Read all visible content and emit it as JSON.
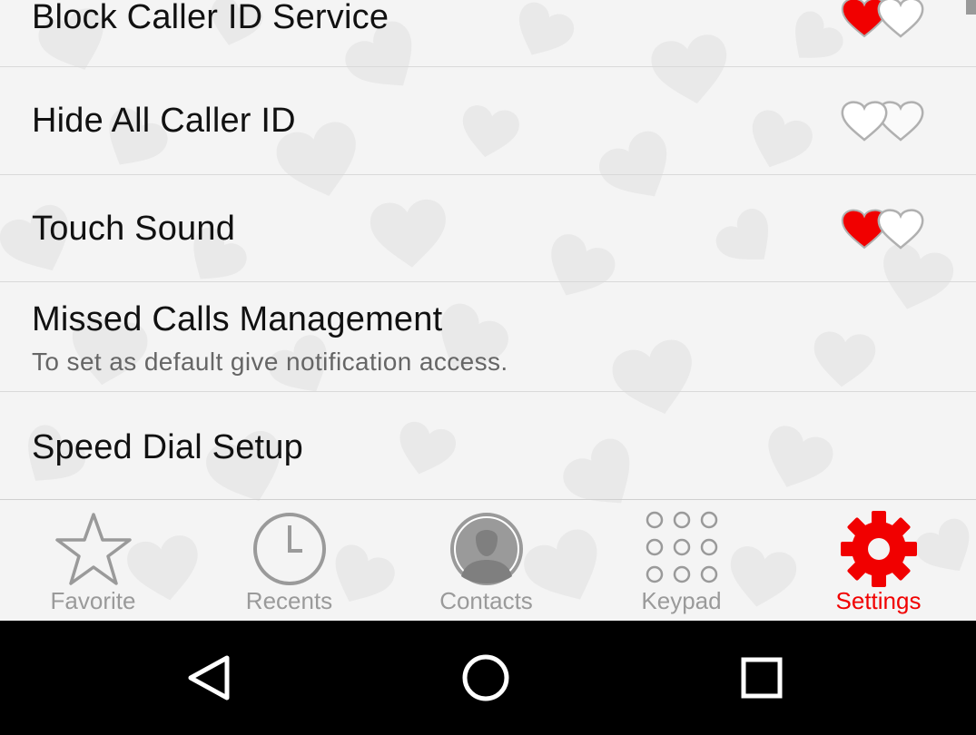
{
  "colors": {
    "accent": "#f10000",
    "inactive": "#9a9a9a",
    "divider": "#d9d9d9",
    "navbar": "#000000"
  },
  "settings": [
    {
      "title": "Block Caller ID Service",
      "toggle": "on"
    },
    {
      "title": "Hide All Caller ID",
      "toggle": "off"
    },
    {
      "title": "Touch Sound",
      "toggle": "on"
    },
    {
      "title": "Missed Calls Management",
      "subtitle": "To set as default give notification access."
    },
    {
      "title": "Speed Dial Setup"
    }
  ],
  "tabs": [
    {
      "label": "Favorite",
      "icon": "star-icon"
    },
    {
      "label": "Recents",
      "icon": "clock-icon"
    },
    {
      "label": "Contacts",
      "icon": "person-icon"
    },
    {
      "label": "Keypad",
      "icon": "keypad-icon"
    },
    {
      "label": "Settings",
      "icon": "gear-icon",
      "active": true
    }
  ],
  "system_nav": [
    {
      "icon": "back-icon"
    },
    {
      "icon": "home-icon"
    },
    {
      "icon": "recents-square-icon"
    }
  ]
}
